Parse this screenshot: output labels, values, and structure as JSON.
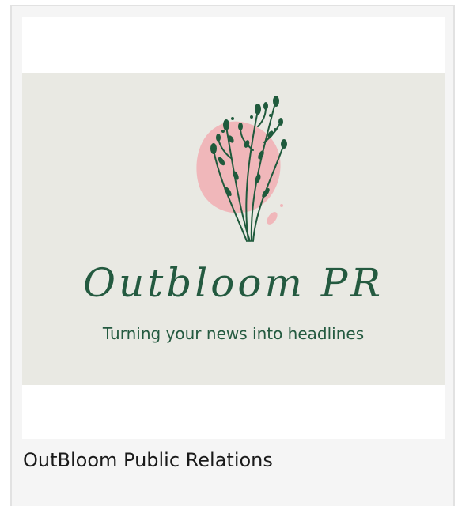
{
  "card": {
    "logo": {
      "brand_name": "Outbloom PR",
      "tagline": "Turning your news into headlines",
      "art_icon": "flower-sprig-icon",
      "colors": {
        "background": "#e9e9e3",
        "blob": "#f0b7ba",
        "foliage": "#1f5a3c"
      }
    },
    "caption": "OutBloom Public Relations"
  }
}
